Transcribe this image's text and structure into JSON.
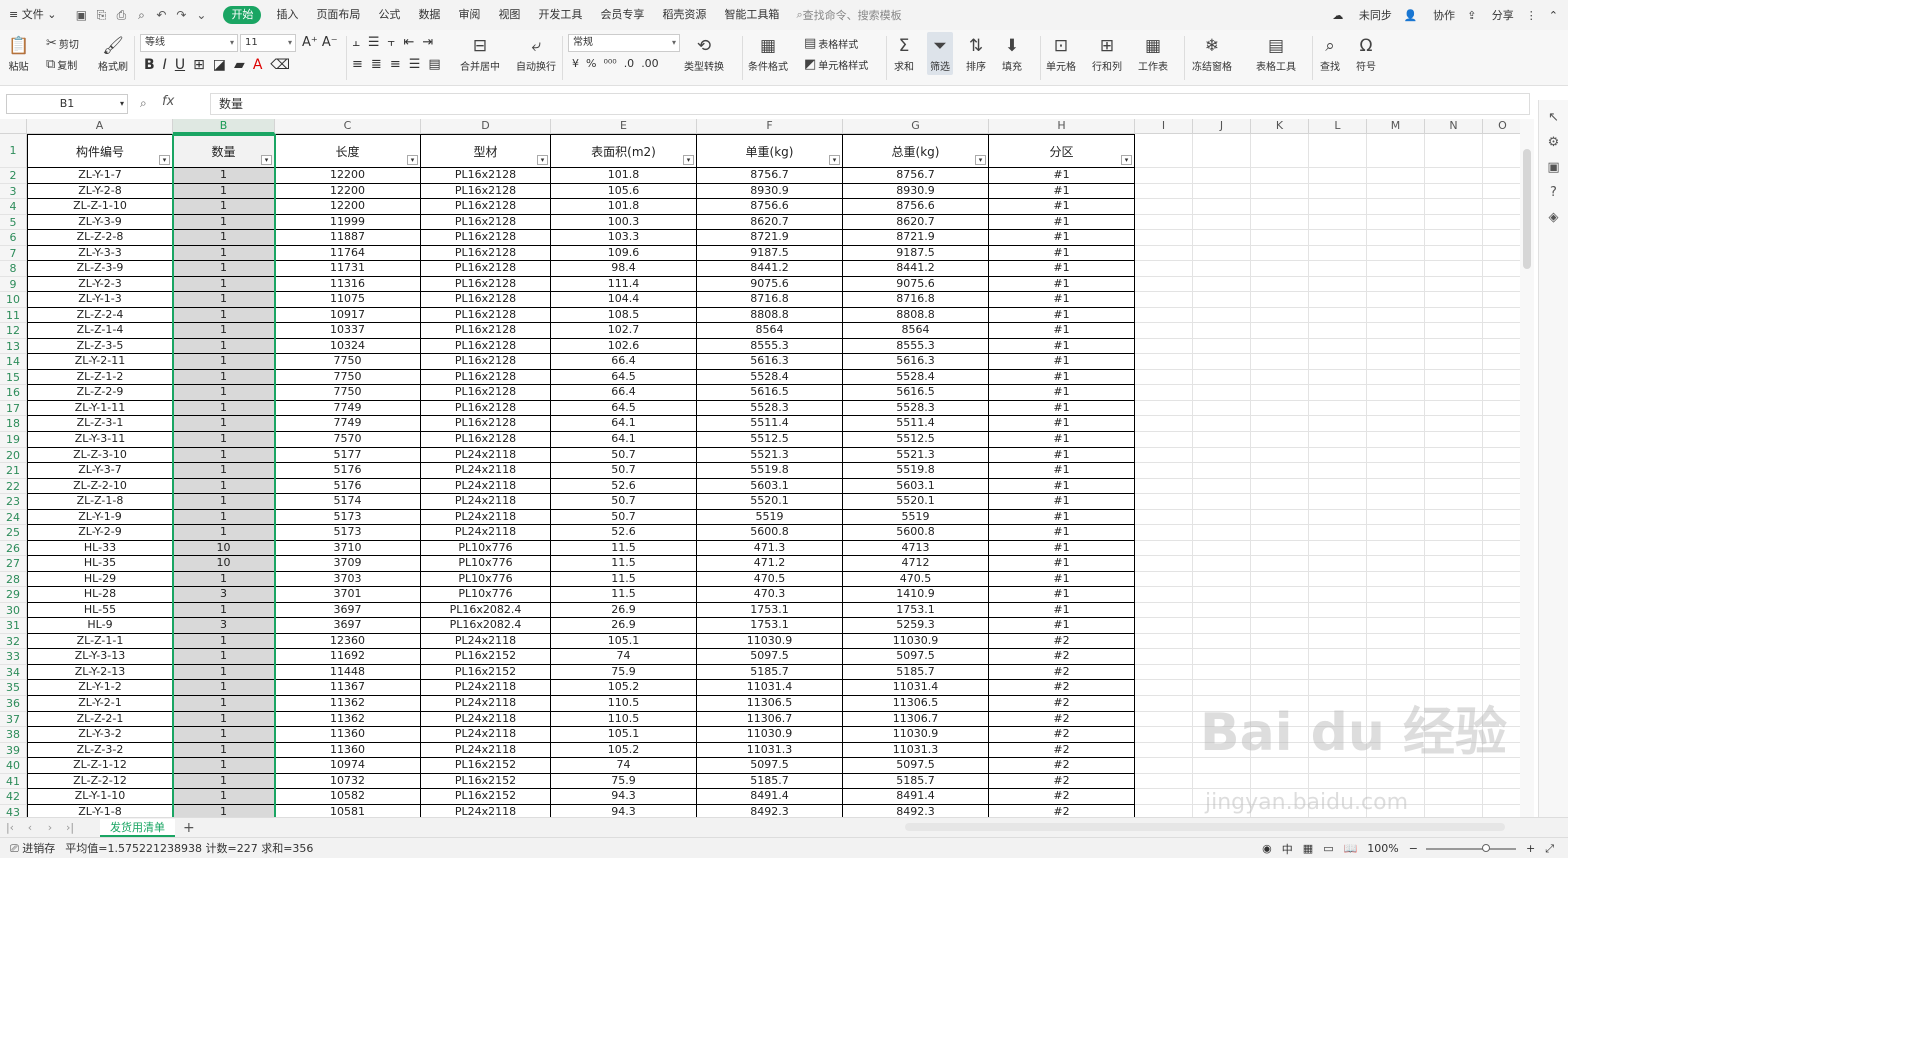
{
  "menubar": {
    "file": "文件",
    "tabs": [
      "开始",
      "插入",
      "页面布局",
      "公式",
      "数据",
      "审阅",
      "视图",
      "开发工具",
      "会员专享",
      "稻壳资源",
      "智能工具箱"
    ],
    "active_index": 0,
    "search_placeholder": "查找命令、搜索模板",
    "right": [
      "未同步",
      "协作",
      "分享"
    ]
  },
  "ribbon": {
    "paste": "粘贴",
    "cut": "剪切",
    "copy": "复制",
    "format_painter": "格式刷",
    "font_name": "等线",
    "font_size": "11",
    "merge": "合并居中",
    "wrap": "自动换行",
    "number_format": "常规",
    "type_convert": "类型转换",
    "cond_format": "条件格式",
    "table_style": "表格样式",
    "cell_style": "单元格样式",
    "sum": "求和",
    "filter": "筛选",
    "sort": "排序",
    "fill": "填充",
    "cell": "单元格",
    "row_col": "行和列",
    "worksheet": "工作表",
    "freeze": "冻结窗格",
    "table_tools": "表格工具",
    "find": "查找",
    "symbol": "符号"
  },
  "formula_bar": {
    "name_box": "B1",
    "fx": "fx",
    "content": "数量"
  },
  "sheet": {
    "columns": [
      "A",
      "B",
      "C",
      "D",
      "E",
      "F",
      "G",
      "H",
      "I",
      "J",
      "K",
      "L",
      "M",
      "N",
      "O"
    ],
    "headers": [
      "构件编号",
      "数量",
      "长度",
      "型材",
      "表面积(m2)",
      "单重(kg)",
      "总重(kg)",
      "分区"
    ],
    "rows": [
      [
        "ZL-Y-1-7",
        "1",
        "12200",
        "PL16x2128",
        "101.8",
        "8756.7",
        "8756.7",
        "#1"
      ],
      [
        "ZL-Y-2-8",
        "1",
        "12200",
        "PL16x2128",
        "105.6",
        "8930.9",
        "8930.9",
        "#1"
      ],
      [
        "ZL-Z-1-10",
        "1",
        "12200",
        "PL16x2128",
        "101.8",
        "8756.6",
        "8756.6",
        "#1"
      ],
      [
        "ZL-Y-3-9",
        "1",
        "11999",
        "PL16x2128",
        "100.3",
        "8620.7",
        "8620.7",
        "#1"
      ],
      [
        "ZL-Z-2-8",
        "1",
        "11887",
        "PL16x2128",
        "103.3",
        "8721.9",
        "8721.9",
        "#1"
      ],
      [
        "ZL-Y-3-3",
        "1",
        "11764",
        "PL16x2128",
        "109.6",
        "9187.5",
        "9187.5",
        "#1"
      ],
      [
        "ZL-Z-3-9",
        "1",
        "11731",
        "PL16x2128",
        "98.4",
        "8441.2",
        "8441.2",
        "#1"
      ],
      [
        "ZL-Y-2-3",
        "1",
        "11316",
        "PL16x2128",
        "111.4",
        "9075.6",
        "9075.6",
        "#1"
      ],
      [
        "ZL-Y-1-3",
        "1",
        "11075",
        "PL16x2128",
        "104.4",
        "8716.8",
        "8716.8",
        "#1"
      ],
      [
        "ZL-Z-2-4",
        "1",
        "10917",
        "PL16x2128",
        "108.5",
        "8808.8",
        "8808.8",
        "#1"
      ],
      [
        "ZL-Z-1-4",
        "1",
        "10337",
        "PL16x2128",
        "102.7",
        "8564",
        "8564",
        "#1"
      ],
      [
        "ZL-Z-3-5",
        "1",
        "10324",
        "PL16x2128",
        "102.6",
        "8555.3",
        "8555.3",
        "#1"
      ],
      [
        "ZL-Y-2-11",
        "1",
        "7750",
        "PL16x2128",
        "66.4",
        "5616.3",
        "5616.3",
        "#1"
      ],
      [
        "ZL-Z-1-2",
        "1",
        "7750",
        "PL16x2128",
        "64.5",
        "5528.4",
        "5528.4",
        "#1"
      ],
      [
        "ZL-Z-2-9",
        "1",
        "7750",
        "PL16x2128",
        "66.4",
        "5616.5",
        "5616.5",
        "#1"
      ],
      [
        "ZL-Y-1-11",
        "1",
        "7749",
        "PL16x2128",
        "64.5",
        "5528.3",
        "5528.3",
        "#1"
      ],
      [
        "ZL-Z-3-1",
        "1",
        "7749",
        "PL16x2128",
        "64.1",
        "5511.4",
        "5511.4",
        "#1"
      ],
      [
        "ZL-Y-3-11",
        "1",
        "7570",
        "PL16x2128",
        "64.1",
        "5512.5",
        "5512.5",
        "#1"
      ],
      [
        "ZL-Z-3-10",
        "1",
        "5177",
        "PL24x2118",
        "50.7",
        "5521.3",
        "5521.3",
        "#1"
      ],
      [
        "ZL-Y-3-7",
        "1",
        "5176",
        "PL24x2118",
        "50.7",
        "5519.8",
        "5519.8",
        "#1"
      ],
      [
        "ZL-Z-2-10",
        "1",
        "5176",
        "PL24x2118",
        "52.6",
        "5603.1",
        "5603.1",
        "#1"
      ],
      [
        "ZL-Z-1-8",
        "1",
        "5174",
        "PL24x2118",
        "50.7",
        "5520.1",
        "5520.1",
        "#1"
      ],
      [
        "ZL-Y-1-9",
        "1",
        "5173",
        "PL24x2118",
        "50.7",
        "5519",
        "5519",
        "#1"
      ],
      [
        "ZL-Y-2-9",
        "1",
        "5173",
        "PL24x2118",
        "52.6",
        "5600.8",
        "5600.8",
        "#1"
      ],
      [
        "HL-33",
        "10",
        "3710",
        "PL10x776",
        "11.5",
        "471.3",
        "4713",
        "#1"
      ],
      [
        "HL-35",
        "10",
        "3709",
        "PL10x776",
        "11.5",
        "471.2",
        "4712",
        "#1"
      ],
      [
        "HL-29",
        "1",
        "3703",
        "PL10x776",
        "11.5",
        "470.5",
        "470.5",
        "#1"
      ],
      [
        "HL-28",
        "3",
        "3701",
        "PL10x776",
        "11.5",
        "470.3",
        "1410.9",
        "#1"
      ],
      [
        "HL-55",
        "1",
        "3697",
        "PL16x2082.4",
        "26.9",
        "1753.1",
        "1753.1",
        "#1"
      ],
      [
        "HL-9",
        "3",
        "3697",
        "PL16x2082.4",
        "26.9",
        "1753.1",
        "5259.3",
        "#1"
      ],
      [
        "ZL-Z-1-1",
        "1",
        "12360",
        "PL24x2118",
        "105.1",
        "11030.9",
        "11030.9",
        "#2"
      ],
      [
        "ZL-Y-3-13",
        "1",
        "11692",
        "PL16x2152",
        "74",
        "5097.5",
        "5097.5",
        "#2"
      ],
      [
        "ZL-Y-2-13",
        "1",
        "11448",
        "PL16x2152",
        "75.9",
        "5185.7",
        "5185.7",
        "#2"
      ],
      [
        "ZL-Y-1-2",
        "1",
        "11367",
        "PL24x2118",
        "105.2",
        "11031.4",
        "11031.4",
        "#2"
      ],
      [
        "ZL-Y-2-1",
        "1",
        "11362",
        "PL24x2118",
        "110.5",
        "11306.5",
        "11306.5",
        "#2"
      ],
      [
        "ZL-Z-2-1",
        "1",
        "11362",
        "PL24x2118",
        "110.5",
        "11306.7",
        "11306.7",
        "#2"
      ],
      [
        "ZL-Y-3-2",
        "1",
        "11360",
        "PL24x2118",
        "105.1",
        "11030.9",
        "11030.9",
        "#2"
      ],
      [
        "ZL-Z-3-2",
        "1",
        "11360",
        "PL24x2118",
        "105.2",
        "11031.3",
        "11031.3",
        "#2"
      ],
      [
        "ZL-Z-1-12",
        "1",
        "10974",
        "PL16x2152",
        "74",
        "5097.5",
        "5097.5",
        "#2"
      ],
      [
        "ZL-Z-2-12",
        "1",
        "10732",
        "PL16x2152",
        "75.9",
        "5185.7",
        "5185.7",
        "#2"
      ],
      [
        "ZL-Y-1-10",
        "1",
        "10582",
        "PL16x2152",
        "94.3",
        "8491.4",
        "8491.4",
        "#2"
      ],
      [
        "ZL-Y-1-8",
        "1",
        "10581",
        "PL24x2118",
        "94.3",
        "8492.3",
        "8492.3",
        "#2"
      ]
    ],
    "sheet_tab": "发货用清单"
  },
  "status": {
    "mode": "进销存",
    "stats": "平均值=1.575221238938  计数=227  求和=356",
    "zoom": "100%"
  },
  "watermark": {
    "logo": "Bai du 经验",
    "url": "jingyan.baidu.com"
  },
  "colors": {
    "accent": "#1aa563",
    "selection": "#d9d9d9"
  }
}
